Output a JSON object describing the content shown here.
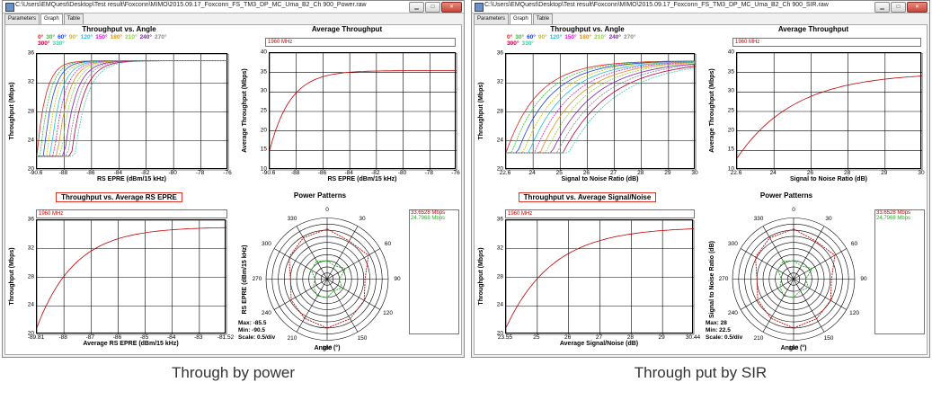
{
  "windows": [
    {
      "title": "C:\\Users\\EMQuest\\Desktop\\Test result\\Foxconn\\MIMO\\2015.09.17_Foxconn_FS_TM3_DP_MC_Uma_B2_Ch 900_Power.raw",
      "tabs": [
        "Parameters",
        "Graph",
        "Table"
      ],
      "caption": "Through by power",
      "charts": {
        "angle": {
          "title": "Throughput vs. Angle",
          "ylabel": "Throughput (Mbps)",
          "xlabel": "RS EPRE (dBm/15 kHz)",
          "xticks": [
            "-90.6",
            "-88",
            "-86",
            "-84",
            "-82",
            "-80",
            "-78",
            "-76"
          ],
          "yticks": [
            "36",
            "32",
            "28",
            "24",
            "20"
          ]
        },
        "avg": {
          "title": "Average Throughput",
          "freq": "1960 MHz",
          "ylabel": "Average Throughput (Mbps)",
          "xlabel": "RS EPRE (dBm/15 kHz)",
          "xticks": [
            "-90.6",
            "-88",
            "-86",
            "-84",
            "-82",
            "-80",
            "-78",
            "-76"
          ],
          "yticks": [
            "40",
            "35",
            "30",
            "25",
            "20",
            "15",
            "10"
          ]
        },
        "vs": {
          "title": "Throughput vs. Average RS EPRE",
          "freq": "1960 MHz",
          "ylabel": "Throughput (Mbps)",
          "xlabel": "Average RS EPRE (dBm/15 kHz)",
          "xticks": [
            "-89.81",
            "-88",
            "-87",
            "-86",
            "-85",
            "-84",
            "-83",
            "-81.52"
          ],
          "yticks": [
            "36",
            "32",
            "28",
            "24",
            "20"
          ]
        },
        "polar": {
          "title": "Power Patterns",
          "ylabel": "RS EPRE (dBm/15 kHz)",
          "xlabel": "Angle (°)",
          "max": "Max: -85.5",
          "min": "Min: -90.5",
          "scale": "Scale: 0.5/div",
          "legend1": "33.6528 Mbps",
          "legend2": "24.7968 Mbps"
        }
      }
    },
    {
      "title": "C:\\Users\\EMQuest\\Desktop\\Test result\\Foxconn\\MIMO\\2015.09.17_Foxconn_FS_TM3_DP_MC_Uma_B2_Ch 900_SIR.raw",
      "tabs": [
        "Parameters",
        "Graph",
        "Table"
      ],
      "caption": "Through put by SIR",
      "charts": {
        "angle": {
          "title": "Throughput vs. Angle",
          "ylabel": "Throughput (Mbps)",
          "xlabel": "Signal to Noise Ratio (dB)",
          "xticks": [
            "22.6",
            "24",
            "25",
            "26",
            "27",
            "28",
            "29",
            "30"
          ],
          "yticks": [
            "36",
            "32",
            "28",
            "24",
            "20"
          ]
        },
        "avg": {
          "title": "Average Throughput",
          "freq": "1960 MHz",
          "ylabel": "Average Throughput (Mbps)",
          "xlabel": "Signal to Noise Ratio (dB)",
          "xticks": [
            "22.6",
            "24",
            "26",
            "28",
            "29",
            "30"
          ],
          "yticks": [
            "40",
            "35",
            "30",
            "25",
            "20",
            "15",
            "10"
          ]
        },
        "vs": {
          "title": "Throughput vs. Average Signal/Noise",
          "freq": "1960 MHz",
          "ylabel": "Throughput (Mbps)",
          "xlabel": "Average Signal/Noise (dB)",
          "xticks": [
            "23.55",
            "25",
            "26",
            "27",
            "28",
            "29",
            "30.44"
          ],
          "yticks": [
            "36",
            "32",
            "28",
            "24",
            "20"
          ]
        },
        "polar": {
          "title": "Power Patterns",
          "ylabel": "Signal to Noise Ratio (dB)",
          "xlabel": "Angle (°)",
          "max": "Max: 28",
          "min": "Min: 22.5",
          "scale": "Scale: 0.5/div",
          "legend1": "33.6528 Mbps",
          "legend2": "24.7968 Mbps"
        }
      }
    }
  ],
  "angle_legend": {
    "labels": [
      "0°",
      "30°",
      "60°",
      "90°",
      "120°",
      "150°",
      "180°",
      "210°",
      "240°",
      "270°",
      "300°",
      "330°"
    ],
    "colors": [
      "#e02020",
      "#30c030",
      "#2040e0",
      "#d0c000",
      "#20c0e0",
      "#d020d0",
      "#e09020",
      "#90d040",
      "#8020c0",
      "#888888",
      "#c00040",
      "#40d0a0"
    ]
  },
  "colors": {
    "avg": "#c00000",
    "polarA": "#c00000",
    "polarB": "#20b020",
    "legend1": "#c00000",
    "legend2": "#20b020"
  },
  "polar_labels": [
    "0",
    "30",
    "60",
    "90",
    "120",
    "150",
    "180",
    "210",
    "240",
    "270",
    "300",
    "330"
  ]
}
